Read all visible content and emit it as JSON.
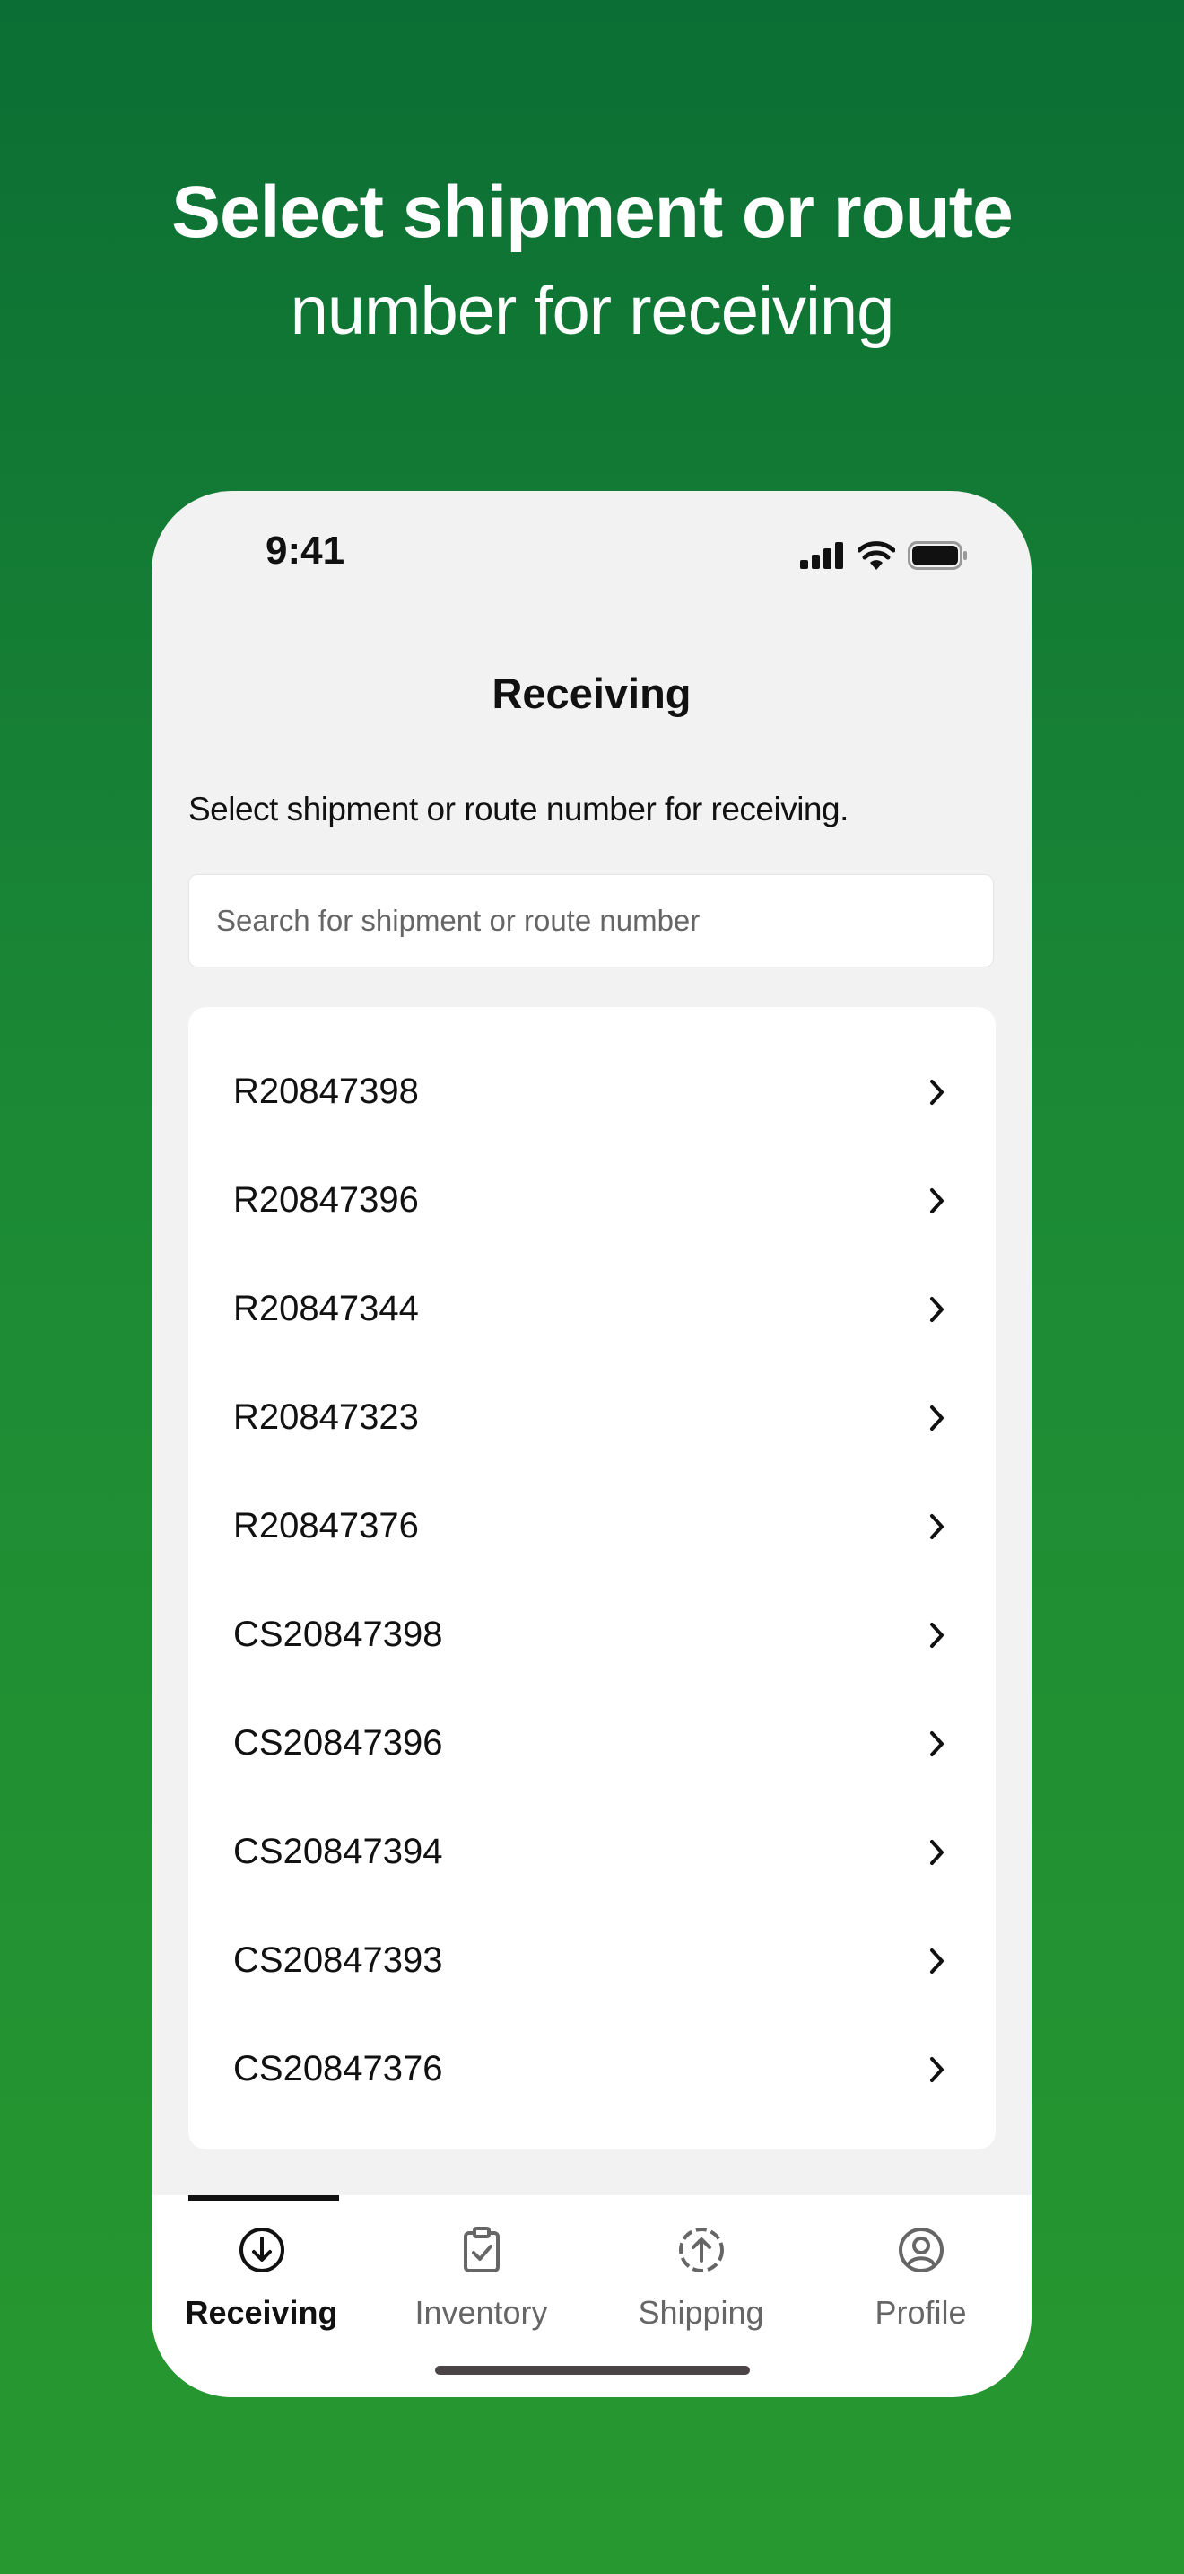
{
  "hero": {
    "line1": "Select shipment or route",
    "line2": "number for receiving"
  },
  "status_bar": {
    "time": "9:41",
    "icons": [
      "cellular-signal-icon",
      "wifi-icon",
      "battery-icon"
    ]
  },
  "screen": {
    "title": "Receiving",
    "subtitle": "Select shipment or route number for receiving.",
    "search_placeholder": "Search for shipment or route number"
  },
  "list_items": [
    {
      "label": "R20847398"
    },
    {
      "label": "R20847396"
    },
    {
      "label": "R20847344"
    },
    {
      "label": "R20847323"
    },
    {
      "label": "R20847376"
    },
    {
      "label": "CS20847398"
    },
    {
      "label": "CS20847396"
    },
    {
      "label": "CS20847394"
    },
    {
      "label": "CS20847393"
    },
    {
      "label": "CS20847376"
    }
  ],
  "tabs": [
    {
      "label": "Receiving",
      "icon": "download-circle-icon",
      "active": true
    },
    {
      "label": "Inventory",
      "icon": "clipboard-check-icon",
      "active": false
    },
    {
      "label": "Shipping",
      "icon": "upload-circle-icon",
      "active": false
    },
    {
      "label": "Profile",
      "icon": "user-circle-icon",
      "active": false
    }
  ],
  "colors": {
    "background_top": "#0b6e34",
    "background_bottom": "#27982f",
    "active_tab": "#111111",
    "inactive_tab": "#666666"
  }
}
